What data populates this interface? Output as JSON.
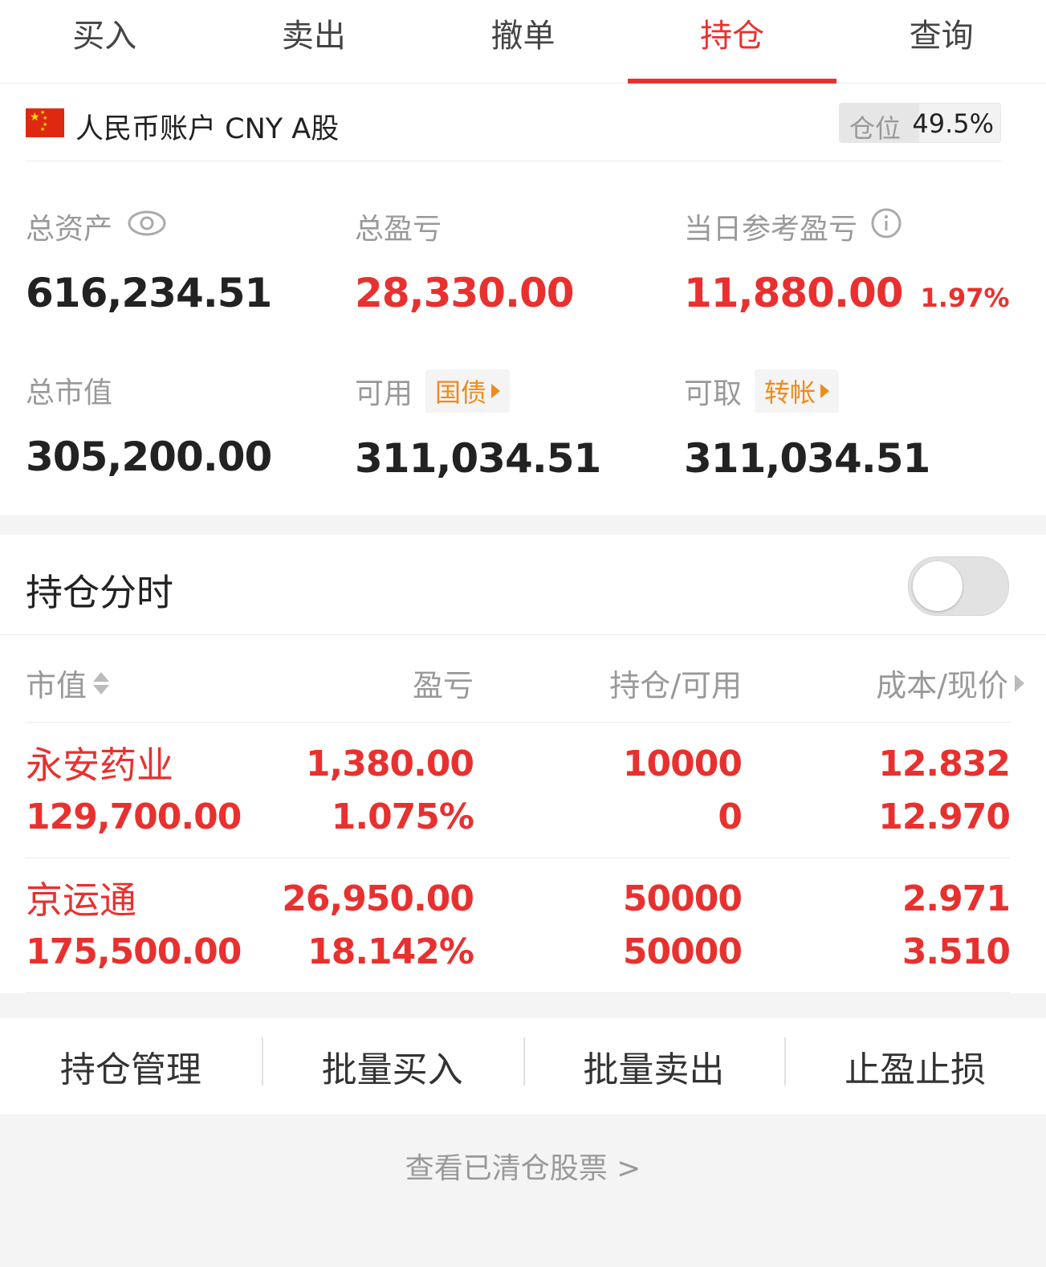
{
  "tabs": [
    {
      "label": "买入",
      "active": false
    },
    {
      "label": "卖出",
      "active": false
    },
    {
      "label": "撤单",
      "active": false
    },
    {
      "label": "持仓",
      "active": true
    },
    {
      "label": "查询",
      "active": false
    }
  ],
  "account": {
    "name": "人民币账户 CNY A股",
    "position_label": "仓位",
    "position_value": "49.5%",
    "position_ratio": 0.495
  },
  "summary": {
    "total_assets_label": "总资产",
    "total_assets": "616,234.51",
    "total_pl_label": "总盈亏",
    "total_pl": "28,330.00",
    "daily_pl_label": "当日参考盈亏",
    "daily_pl": "11,880.00",
    "daily_pl_pct": "1.97%",
    "market_value_label": "总市值",
    "market_value": "305,200.00",
    "available_label": "可用",
    "available_tag": "国债",
    "available": "311,034.51",
    "withdrawable_label": "可取",
    "withdrawable_tag": "转帐",
    "withdrawable": "311,034.51"
  },
  "timeshare": {
    "title": "持仓分时",
    "enabled": false
  },
  "table": {
    "headers": {
      "market_value": "市值",
      "pl": "盈亏",
      "holding": "持仓/可用",
      "cost": "成本/现价"
    },
    "rows": [
      {
        "name": "永安药业",
        "market_value": "129,700.00",
        "pl": "1,380.00",
        "pl_pct": "1.075%",
        "holding": "10000",
        "available": "0",
        "cost": "12.832",
        "price": "12.970"
      },
      {
        "name": "京运通",
        "market_value": "175,500.00",
        "pl": "26,950.00",
        "pl_pct": "18.142%",
        "holding": "50000",
        "available": "50000",
        "cost": "2.971",
        "price": "3.510"
      }
    ]
  },
  "actions": [
    "持仓管理",
    "批量买入",
    "批量卖出",
    "止盈止损"
  ],
  "cleared_link": "查看已清仓股票 >",
  "colors": {
    "accent": "#e8312f",
    "tag": "#f08a1c"
  },
  "icons": [
    "cn-flag-icon",
    "eye-icon",
    "info-icon",
    "sort-icon",
    "chevron-right-icon",
    "arrow-right-icon"
  ]
}
